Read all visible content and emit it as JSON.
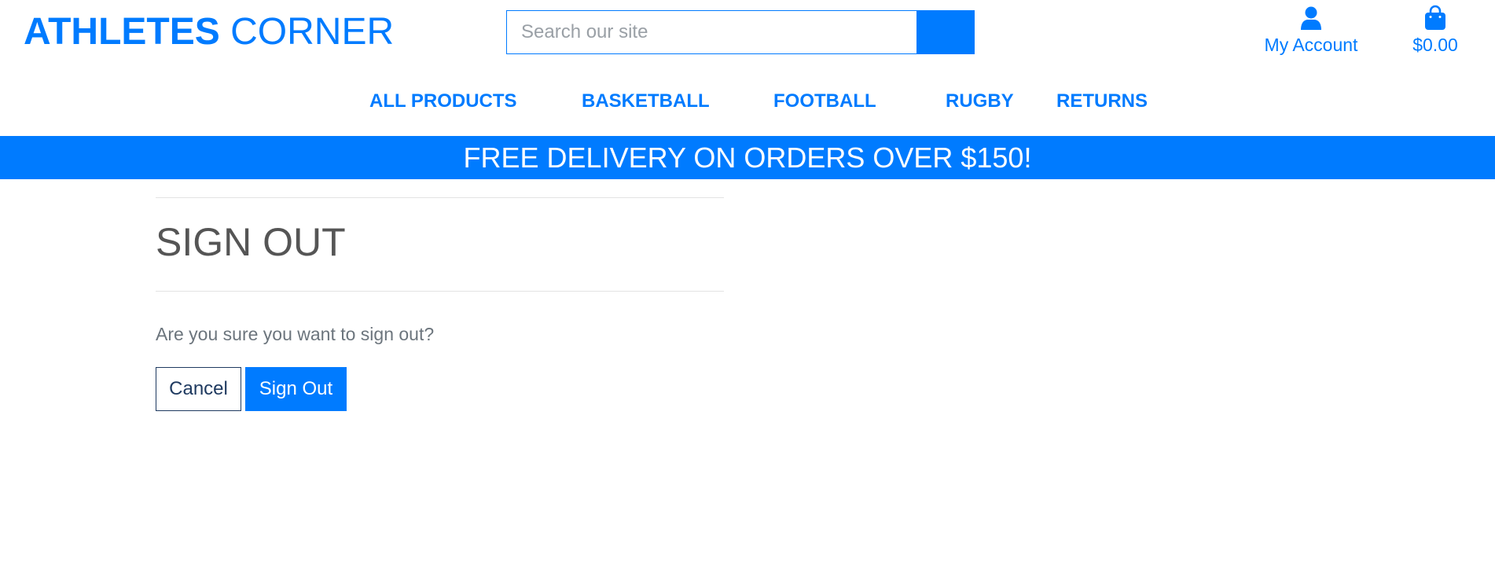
{
  "header": {
    "logo_bold": "ATHLETES",
    "logo_light": "CORNER",
    "search_placeholder": "Search our site",
    "search_value": "",
    "account_label": "My Account",
    "cart_total": "$0.00"
  },
  "nav": {
    "items": [
      {
        "label": "ALL PRODUCTS"
      },
      {
        "label": "BASKETBALL"
      },
      {
        "label": "FOOTBALL"
      },
      {
        "label": "RUGBY"
      },
      {
        "label": "RETURNS"
      }
    ]
  },
  "banner": {
    "text": "FREE DELIVERY ON ORDERS OVER $150!"
  },
  "main": {
    "title": "SIGN OUT",
    "message": "Are you sure you want to sign out?",
    "cancel_label": "Cancel",
    "signout_label": "Sign Out"
  },
  "icons": {
    "search": "search-icon",
    "account": "user-icon",
    "cart": "shopping-bag-icon"
  },
  "colors": {
    "brand": "#007bff",
    "title_text": "#555555",
    "muted_text": "#6c757d",
    "cancel_border": "#1f3a60"
  }
}
